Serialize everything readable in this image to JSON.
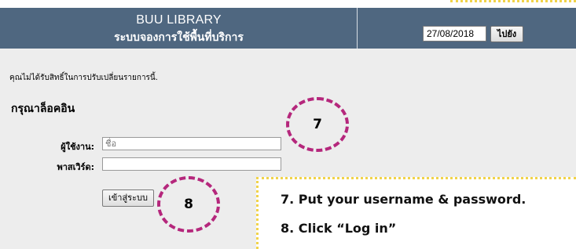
{
  "header": {
    "title_en": "BUU LIBRARY",
    "title_th": "ระบบจองการใช้พื้นที่บริการ",
    "date_value": "27/08/2018",
    "go_label": "ไปยัง"
  },
  "main": {
    "notice": "คุณไม่ได้รับสิทธิ์ในการปรับเปลี่ยนรายการนี้.",
    "login_heading": "กรุณาล็อคอิน",
    "username_label": "ผู้ใช้งาน:",
    "username_placeholder": "ชื่อ",
    "password_label": "พาสเวิร์ด:",
    "login_button": "เข้าสู่ระบบ"
  },
  "annotations": {
    "step7_marker": "7",
    "step8_marker": "8",
    "instruction1": "7. Put your username & password.",
    "instruction2": "8. Click “Log in”",
    "marker_color": "#b5277c",
    "box_color": "#f1d34a"
  },
  "colors": {
    "header_bg": "#4f6780",
    "content_bg": "#ededed"
  }
}
